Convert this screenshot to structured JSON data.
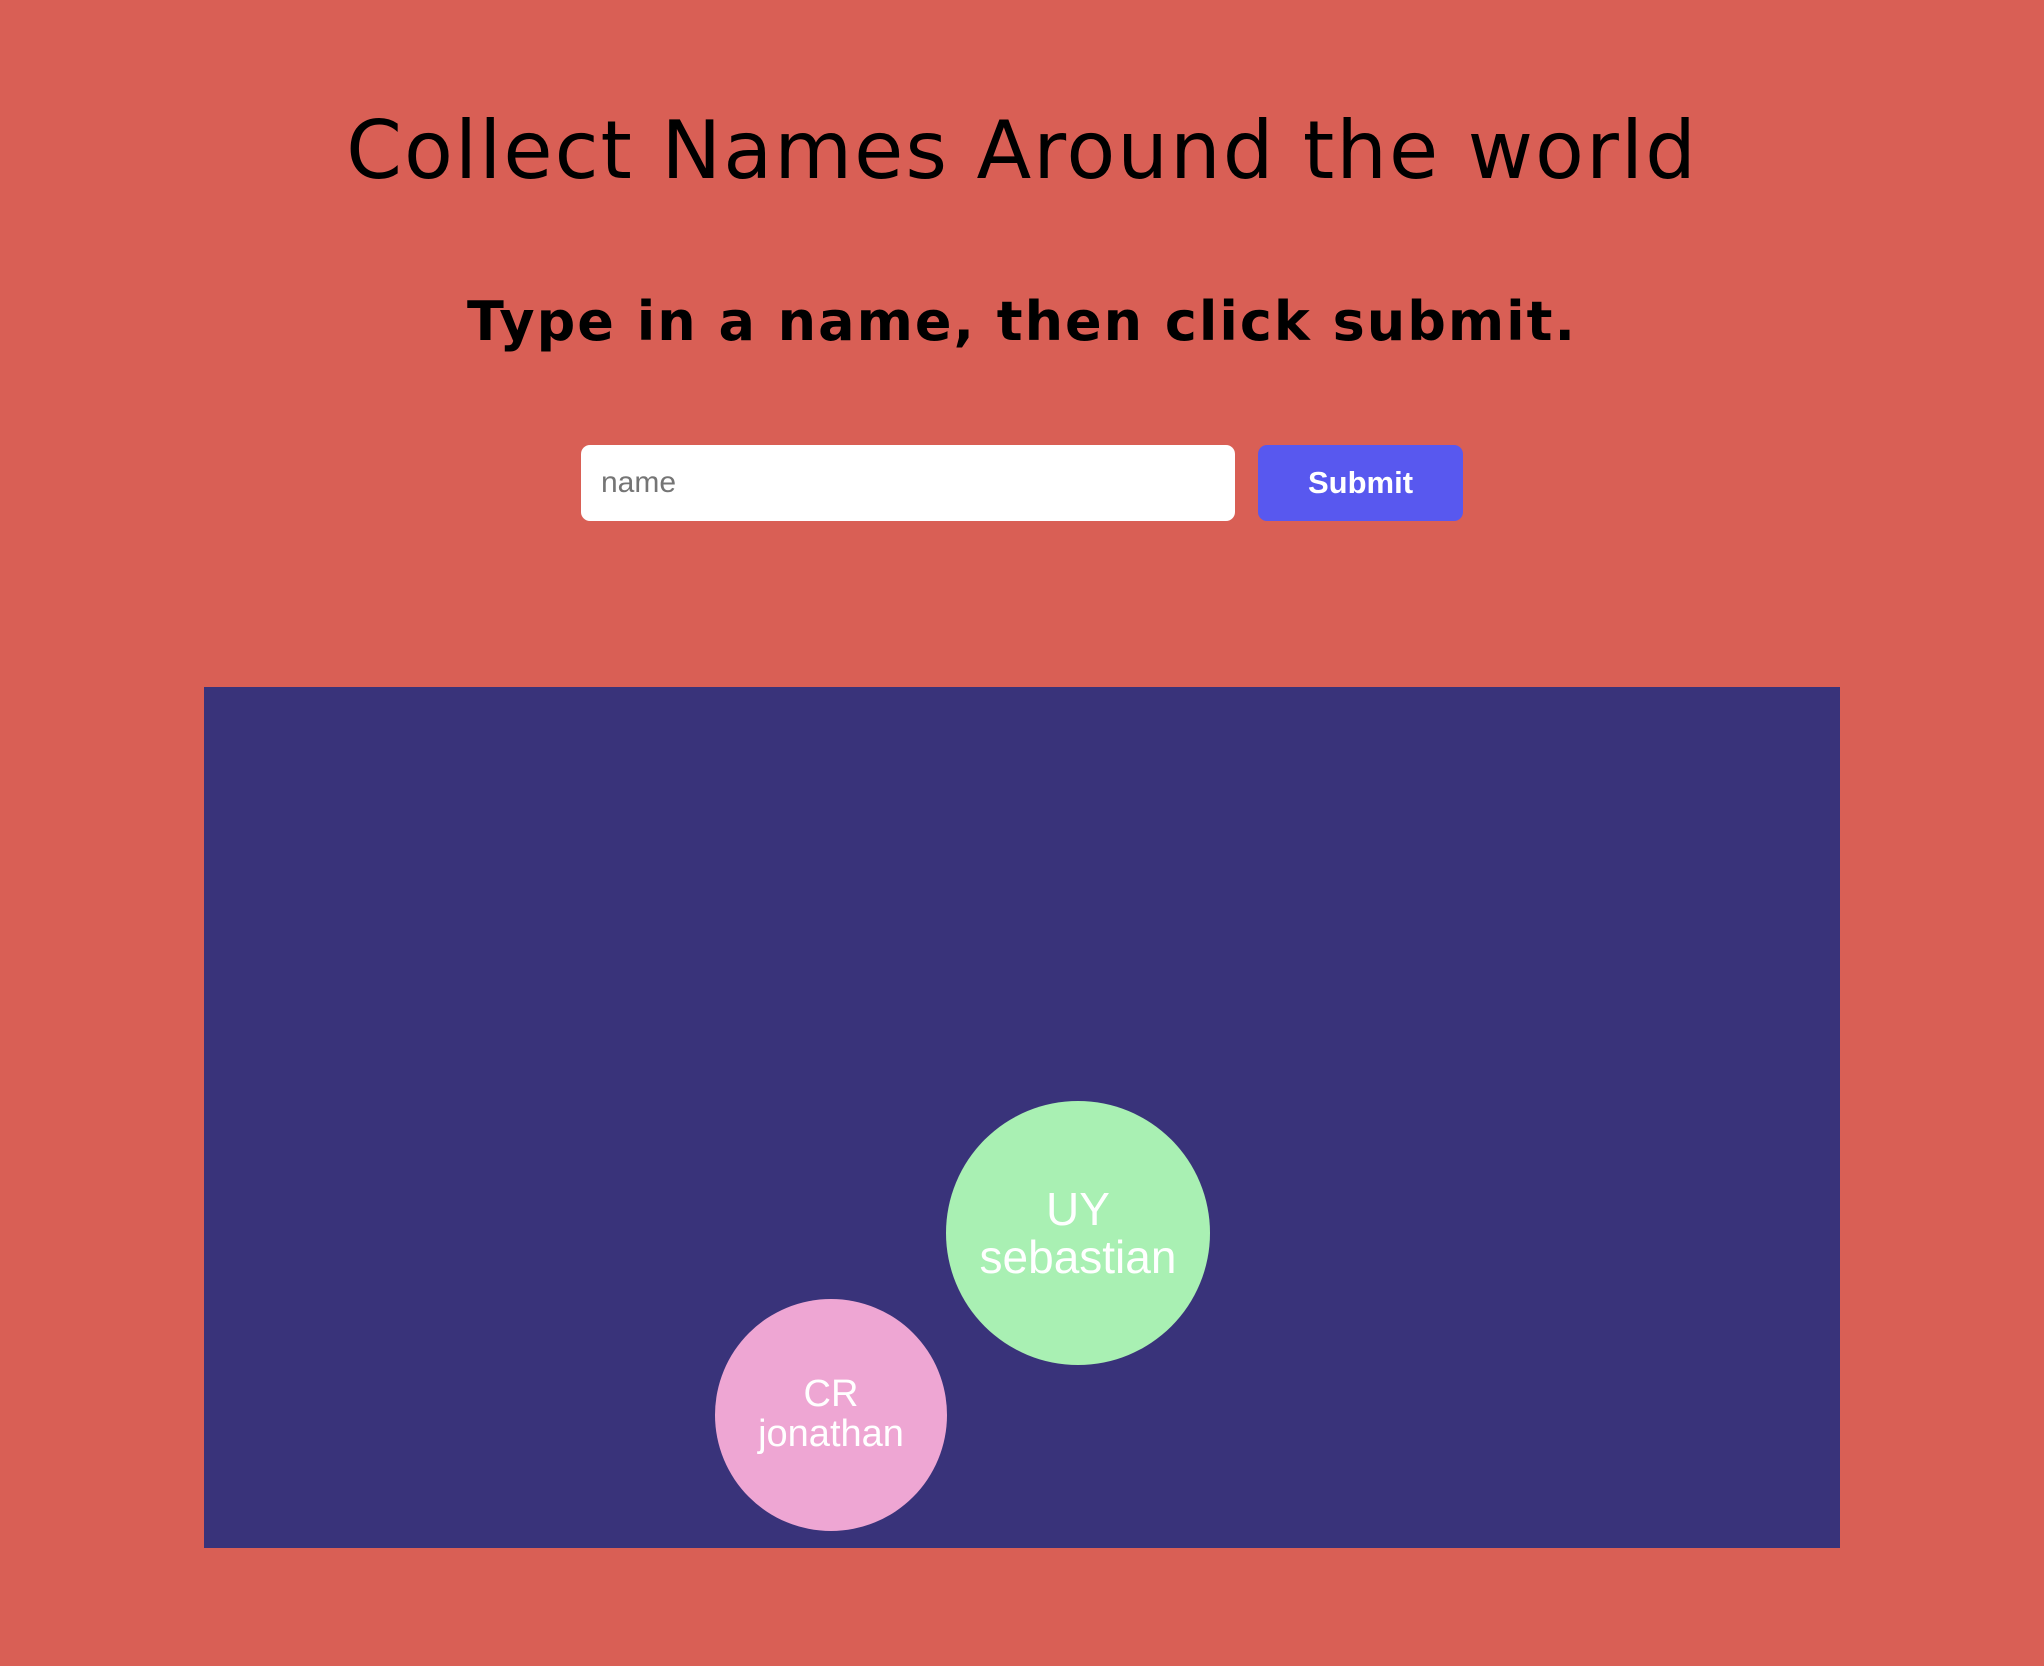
{
  "header": {
    "title": "Collect Names Around the world",
    "subtitle": "Type in a name, then click submit."
  },
  "form": {
    "name_placeholder": "name",
    "name_value": "",
    "submit_label": "Submit"
  },
  "colors": {
    "page_background": "#d95f55",
    "canvas_background": "#39337a",
    "submit_button": "#5858ef",
    "bubble_green": "#a9f0b3",
    "bubble_pink": "#eea6d3"
  },
  "bubbles": [
    {
      "country": "UY",
      "name": "sebastian",
      "color": "#a9f0b3"
    },
    {
      "country": "CR",
      "name": "jonathan",
      "color": "#eea6d3"
    }
  ]
}
